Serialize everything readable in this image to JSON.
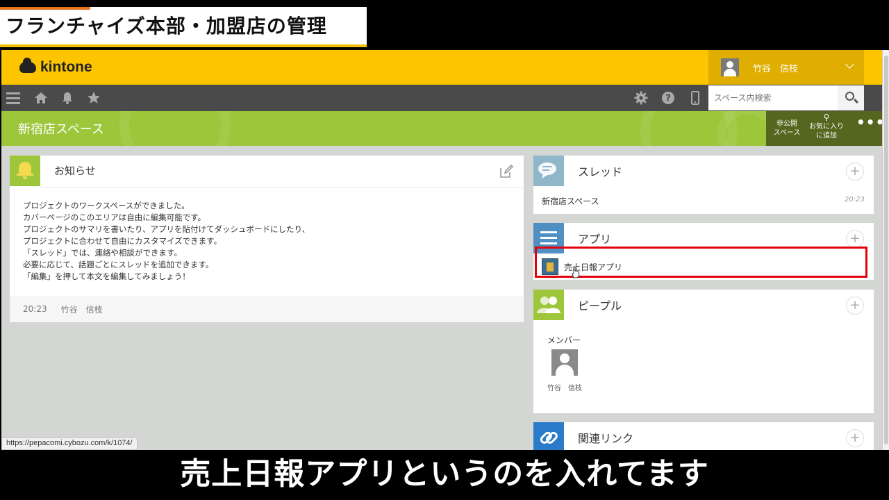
{
  "caption_top": "フランチャイズ本部・加盟店の管理",
  "caption_bottom": "売上日報アプリというのを入れてます",
  "header": {
    "brand": "kintone",
    "user_name": "竹谷　信枝",
    "brand_color": "#fcc500"
  },
  "toolbar": {
    "search_placeholder": "スペース内検索"
  },
  "banner": {
    "space_name": "新宿店スペース",
    "private_label_1": "非公開",
    "private_label_2": "スペース",
    "fav_label_1": "お気に入り",
    "fav_label_2": "に追加",
    "more": "•••",
    "color": "#9dc63b"
  },
  "notice": {
    "title": "お知らせ",
    "body": [
      "プロジェクトのワークスペースができました。",
      "カバーページのこのエリアは自由に編集可能です。",
      "プロジェクトのサマリを書いたり、アプリを貼付けてダッシュボードにしたり、",
      "プロジェクトに合わせて自由にカスタマイズできます。",
      "「スレッド」では、連絡や相談ができます。",
      "必要に応じて、話題ごとにスレッドを追加できます。",
      "「編集」を押して本文を編集してみましょう！"
    ],
    "time": "20:23",
    "author": "竹谷　信枝"
  },
  "thread": {
    "title": "スレッド",
    "item": "新宿店スペース",
    "time": "20:23"
  },
  "apps": {
    "title": "アプリ",
    "item": "売上日報アプリ"
  },
  "people": {
    "title": "ピープル",
    "members_label": "メンバー",
    "member_name": "竹谷　信枝"
  },
  "links": {
    "title": "関連リンク"
  },
  "status_url": "https://pepacomi.cybozu.com/k/1074/",
  "highlight_color": "#e2000b"
}
